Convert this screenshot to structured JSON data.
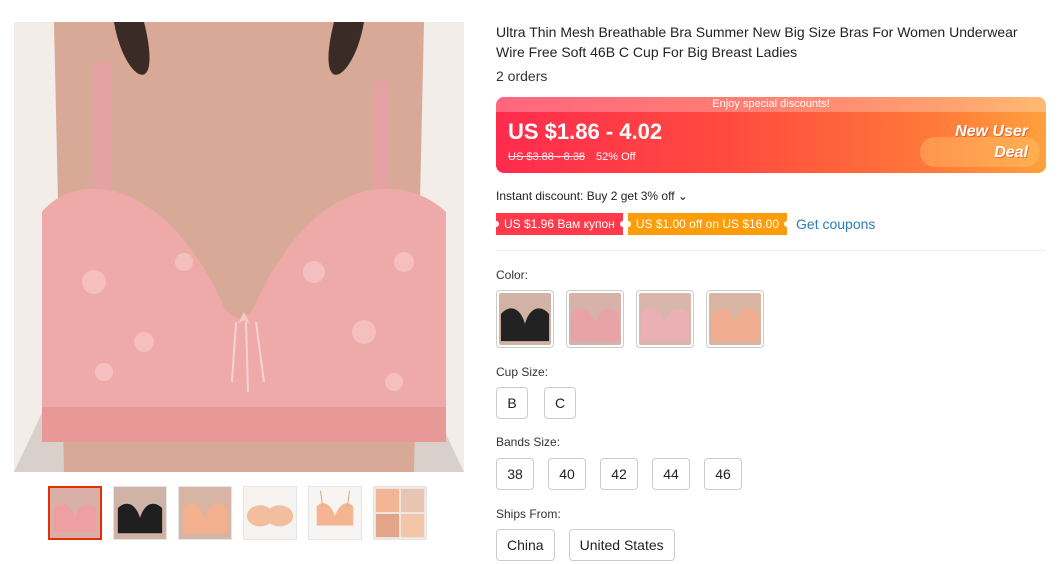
{
  "product": {
    "title": "Ultra Thin Mesh Breathable Bra Summer New Big Size Bras For Women Underwear Wire Free Soft 46B C Cup For Big Breast Ladies",
    "orders": "2 orders"
  },
  "price": {
    "banner": "Enjoy special discounts!",
    "current": "US $1.86 - 4.02",
    "original": "US $3.88 - 8.38",
    "discount": "52% Off",
    "promo_line1": "New User",
    "promo_line2": "Deal",
    "colors": {
      "start": "#ff2b4e",
      "end": "#ffa03c"
    }
  },
  "instant_discount": "Instant discount: Buy 2 get 3% off ⌄",
  "coupons": [
    {
      "text": "US $1.96 Вам купон",
      "color": "#ff3a4b"
    },
    {
      "text": "US $1.00 off on US $16.00",
      "color": "#ff9c0a"
    }
  ],
  "get_coupons": "Get coupons",
  "color_label": "Color:",
  "color_options": [
    {
      "name": "black",
      "fabric": "#222222"
    },
    {
      "name": "pink",
      "fabric": "#e8a3a6"
    },
    {
      "name": "light-pink",
      "fabric": "#eab0b4"
    },
    {
      "name": "skin",
      "fabric": "#f0ad90"
    }
  ],
  "cup_label": "Cup Size:",
  "cup_options": [
    "B",
    "C"
  ],
  "band_label": "Bands Size:",
  "band_options": [
    "38",
    "40",
    "42",
    "44",
    "46"
  ],
  "ships_label": "Ships From:",
  "ships_options": [
    "China",
    "United States"
  ],
  "thumbnails": [
    "pink-front",
    "black-front",
    "skin-front",
    "skin-flat",
    "skin-hanger",
    "collage"
  ]
}
